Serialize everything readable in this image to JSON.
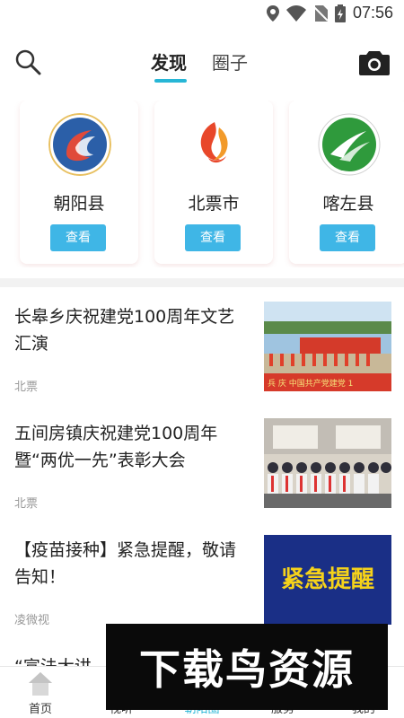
{
  "status_bar": {
    "time": "07:56",
    "icons": [
      "location-icon",
      "wifi-icon",
      "no-sim-icon",
      "battery-icon"
    ]
  },
  "header": {
    "tabs": [
      {
        "label": "发现",
        "active": true
      },
      {
        "label": "圈子",
        "active": false
      }
    ],
    "search_icon": "search-icon",
    "camera_icon": "camera-icon",
    "accent_color": "#27b6d6"
  },
  "counties": [
    {
      "name": "朝阳县",
      "button": "查看"
    },
    {
      "name": "北票市",
      "button": "查看"
    },
    {
      "name": "喀左县",
      "button": "查看"
    }
  ],
  "news": [
    {
      "title": "长皋乡庆祝建党100周年文艺汇演",
      "source": "北票",
      "thumb_text": "兵 庆 中国共产党建党 1"
    },
    {
      "title": "五间房镇庆祝建党100周年暨“两优一先”表彰大会",
      "source": "北票"
    },
    {
      "title": "【疫苗接种】紧急提醒，敬请告知！",
      "source": "凌微视",
      "thumb_text": "紧急提醒"
    },
    {
      "title": "“宣法大讲",
      "source": ""
    }
  ],
  "bottom_nav": [
    {
      "label": "首页"
    },
    {
      "label": "视听"
    },
    {
      "label": "朝阳圈"
    },
    {
      "label": "服务"
    },
    {
      "label": "我的"
    }
  ],
  "watermark": "下载鸟资源"
}
